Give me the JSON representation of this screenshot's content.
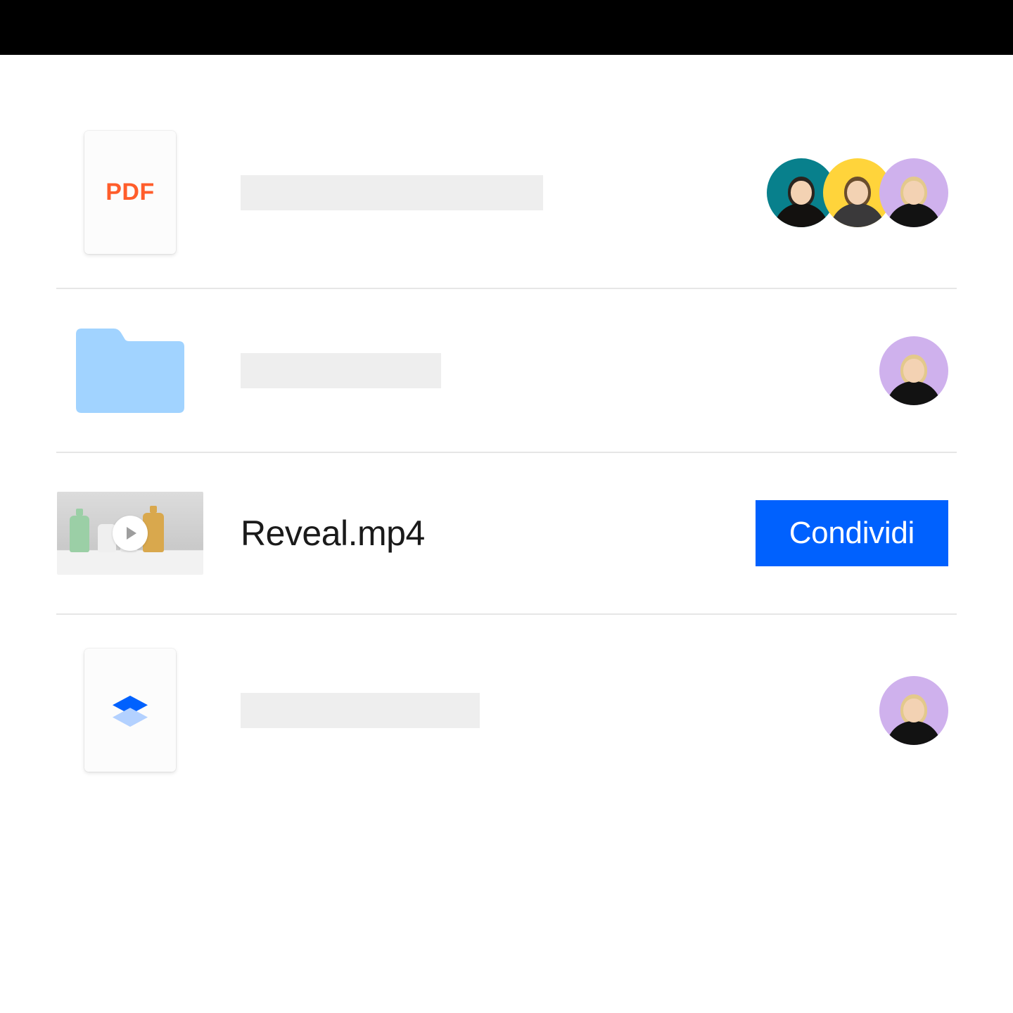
{
  "rows": [
    {
      "type": "pdf",
      "pdf_label": "PDF",
      "name_placeholder": true,
      "placeholder_class": "long",
      "avatars": [
        "teal",
        "yellow",
        "lilac"
      ]
    },
    {
      "type": "folder",
      "name_placeholder": true,
      "placeholder_class": "med",
      "avatars": [
        "lilac"
      ]
    },
    {
      "type": "video",
      "name": "Reveal.mp4",
      "share_label": "Condividi"
    },
    {
      "type": "dropbox",
      "name_placeholder": true,
      "placeholder_class": "med2",
      "avatars": [
        "lilac"
      ]
    }
  ]
}
